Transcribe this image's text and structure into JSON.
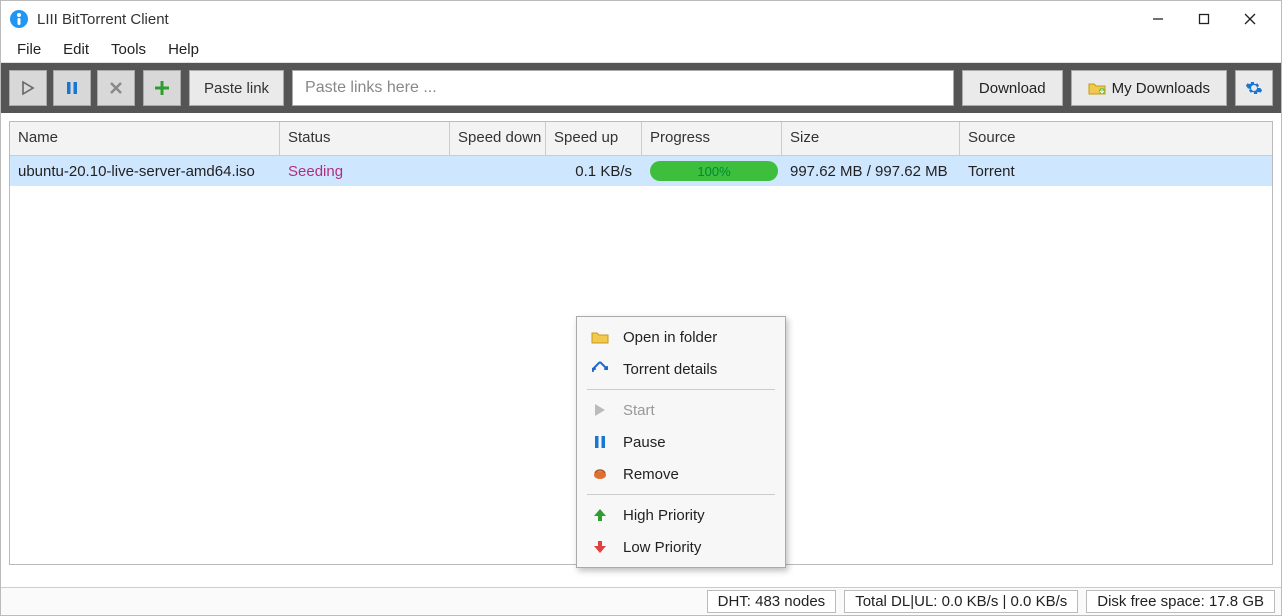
{
  "window": {
    "title": "LIII BitTorrent Client"
  },
  "menu": {
    "file": "File",
    "edit": "Edit",
    "tools": "Tools",
    "help": "Help"
  },
  "toolbar": {
    "paste_link": "Paste link",
    "paste_placeholder": "Paste links here ...",
    "download": "Download",
    "my_downloads": "My Downloads"
  },
  "table": {
    "headers": {
      "name": "Name",
      "status": "Status",
      "speed_down": "Speed down",
      "speed_up": "Speed up",
      "progress": "Progress",
      "size": "Size",
      "source": "Source"
    },
    "rows": [
      {
        "name": "ubuntu-20.10-live-server-amd64.iso",
        "status": "Seeding",
        "speed_down": "",
        "speed_up": "0.1 KB/s",
        "progress": "100%",
        "size": "997.62 MB / 997.62 MB",
        "source": "Torrent"
      }
    ]
  },
  "context_menu": {
    "open_in_folder": "Open in folder",
    "torrent_details": "Torrent details",
    "start": "Start",
    "pause": "Pause",
    "remove": "Remove",
    "high_priority": "High Priority",
    "low_priority": "Low Priority"
  },
  "statusbar": {
    "dht": "DHT: 483 nodes",
    "total": "Total DL|UL: 0.0 KB/s | 0.0 KB/s",
    "disk": "Disk free space: 17.8 GB"
  }
}
